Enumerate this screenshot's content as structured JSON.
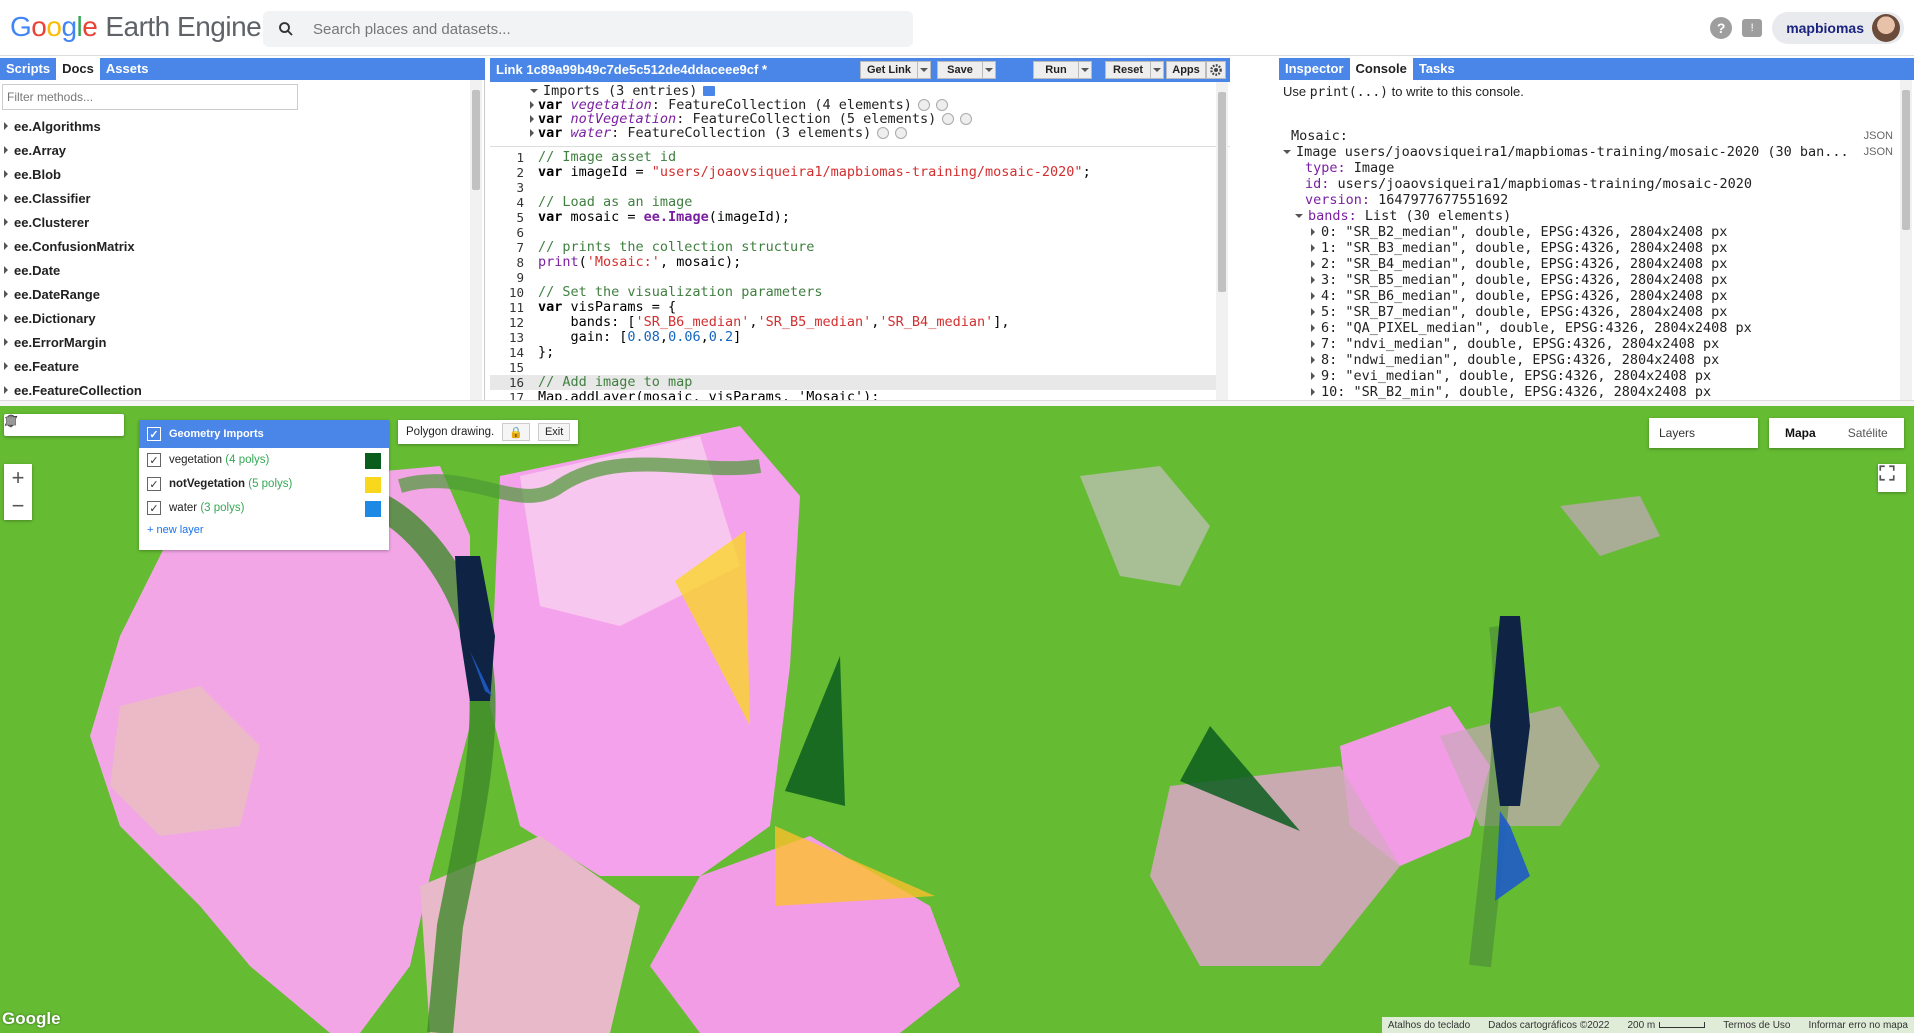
{
  "header": {
    "logo_letters": [
      "G",
      "o",
      "o",
      "g",
      "l",
      "e"
    ],
    "logo_product": "Earth Engine",
    "search_placeholder": "Search places and datasets...",
    "help_icon": "help-icon",
    "feedback_icon": "feedback-icon",
    "user": "mapbiomas"
  },
  "left_panel": {
    "tabs": [
      "Scripts",
      "Docs",
      "Assets"
    ],
    "active_tab": "Docs",
    "filter_placeholder": "Filter methods...",
    "items": [
      "ee.Algorithms",
      "ee.Array",
      "ee.Blob",
      "ee.Classifier",
      "ee.Clusterer",
      "ee.ConfusionMatrix",
      "ee.Date",
      "ee.DateRange",
      "ee.Dictionary",
      "ee.ErrorMargin",
      "ee.Feature",
      "ee.FeatureCollection"
    ]
  },
  "editor": {
    "title": "Link 1c89a99b49c7de5c512de4ddaceee9cf *",
    "buttons": {
      "get_link": "Get Link",
      "save": "Save",
      "run": "Run",
      "reset": "Reset",
      "apps": "Apps"
    },
    "imports_header": "Imports (3 entries)",
    "imports": [
      {
        "name": "vegetation",
        "type": "FeatureCollection (4 elements)"
      },
      {
        "name": "notVegetation",
        "type": "FeatureCollection (5 elements)"
      },
      {
        "name": "water",
        "type": "FeatureCollection (3 elements)"
      }
    ],
    "line_numbers": [
      "1",
      "2",
      "3",
      "4",
      "5",
      "6",
      "7",
      "8",
      "9",
      "10",
      "11",
      "12",
      "13",
      "14",
      "15",
      "16",
      "17"
    ],
    "code": {
      "l1": "// Image asset id",
      "l2_kw": "var",
      "l2_a": " imageId = ",
      "l2_s": "\"users/joaovsiqueira1/mapbiomas-training/mosaic-2020\"",
      "l2_b": ";",
      "l4": "// Load as an image",
      "l5_kw": "var",
      "l5_a": " mosaic = ",
      "l5_f": "ee.Image",
      "l5_b": "(imageId);",
      "l7": "// prints the collection structure",
      "l8_p": "print",
      "l8_a": "(",
      "l8_s": "'Mosaic:'",
      "l8_b": ", mosaic);",
      "l10": "// Set the visualization parameters",
      "l11_kw": "var",
      "l11_a": " visParams = {",
      "l12_a": "    bands: [",
      "l12_s1": "'SR_B6_median'",
      "l12_c1": ",",
      "l12_s2": "'SR_B5_median'",
      "l12_c2": ",",
      "l12_s3": "'SR_B4_median'",
      "l12_b": "],",
      "l13_a": "    gain: [",
      "l13_n1": "0.08",
      "l13_c1": ",",
      "l13_n2": "0.06",
      "l13_c2": ",",
      "l13_n3": "0.2",
      "l13_b": "]",
      "l14": "};",
      "l16": "// Add image to map",
      "l17": "Map.addLayer(mosaic, visParams, 'Mosaic');"
    }
  },
  "right_panel": {
    "tabs": [
      "Inspector",
      "Console",
      "Tasks"
    ],
    "active_tab": "Console",
    "hint_a": "Use ",
    "hint_code": "print(...)",
    "hint_b": " to write to this console.",
    "json_label": "JSON",
    "mosaic_label": "Mosaic:",
    "image_line": "Image users/joaovsiqueira1/mapbiomas-training/mosaic-2020 (30 ban...",
    "type_key": "type:",
    "type_val": " Image",
    "id_key": "id:",
    "id_val": " users/joaovsiqueira1/mapbiomas-training/mosaic-2020",
    "version_key": "version:",
    "version_val": " 1647977677551692",
    "bands_key": "bands:",
    "bands_val": " List (30 elements)",
    "bands": [
      "0: \"SR_B2_median\", double, EPSG:4326, 2804x2408 px",
      "1: \"SR_B3_median\", double, EPSG:4326, 2804x2408 px",
      "2: \"SR_B4_median\", double, EPSG:4326, 2804x2408 px",
      "3: \"SR_B5_median\", double, EPSG:4326, 2804x2408 px",
      "4: \"SR_B6_median\", double, EPSG:4326, 2804x2408 px",
      "5: \"SR_B7_median\", double, EPSG:4326, 2804x2408 px",
      "6: \"QA_PIXEL_median\", double, EPSG:4326, 2804x2408 px",
      "7: \"ndvi_median\", double, EPSG:4326, 2804x2408 px",
      "8: \"ndwi_median\", double, EPSG:4326, 2804x2408 px",
      "9: \"evi_median\", double, EPSG:4326, 2804x2408 px",
      "10: \"SR_B2_min\", double, EPSG:4326, 2804x2408 px"
    ]
  },
  "map": {
    "geometry_imports_title": "Geometry Imports",
    "layers": [
      {
        "name": "vegetation",
        "count": "(4 polys)",
        "color": "#0b5d1e",
        "bold": false
      },
      {
        "name": "notVegetation",
        "count": "(5 polys)",
        "color": "#f9d71c",
        "bold": true
      },
      {
        "name": "water",
        "count": "(3 polys)",
        "color": "#1e88e5",
        "bold": false
      }
    ],
    "new_layer": "+ new layer",
    "polygon_drawing": "Polygon drawing.",
    "exit": "Exit",
    "layers_label": "Layers",
    "map_types": [
      "Mapa",
      "Satélite"
    ],
    "active_map_type": "Mapa",
    "zoom_in": "+",
    "zoom_out": "−",
    "google": "Google",
    "attribution": [
      "Atalhos do teclado",
      "Dados cartográficos ©2022",
      "200 m",
      "Termos de Uso",
      "Informar erro no mapa"
    ]
  }
}
